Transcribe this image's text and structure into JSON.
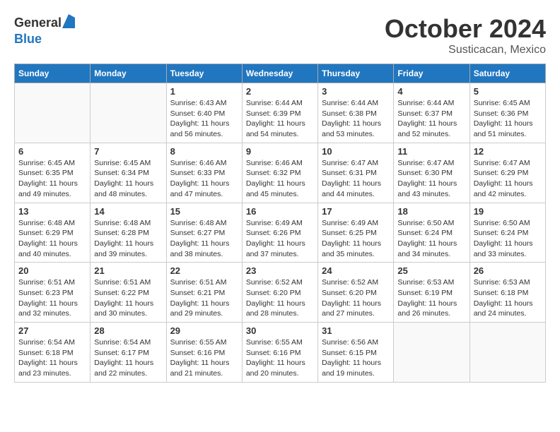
{
  "header": {
    "logo_general": "General",
    "logo_blue": "Blue",
    "month": "October 2024",
    "location": "Susticacan, Mexico"
  },
  "weekdays": [
    "Sunday",
    "Monday",
    "Tuesday",
    "Wednesday",
    "Thursday",
    "Friday",
    "Saturday"
  ],
  "weeks": [
    [
      {
        "day": "",
        "info": ""
      },
      {
        "day": "",
        "info": ""
      },
      {
        "day": "1",
        "info": "Sunrise: 6:43 AM\nSunset: 6:40 PM\nDaylight: 11 hours and 56 minutes."
      },
      {
        "day": "2",
        "info": "Sunrise: 6:44 AM\nSunset: 6:39 PM\nDaylight: 11 hours and 54 minutes."
      },
      {
        "day": "3",
        "info": "Sunrise: 6:44 AM\nSunset: 6:38 PM\nDaylight: 11 hours and 53 minutes."
      },
      {
        "day": "4",
        "info": "Sunrise: 6:44 AM\nSunset: 6:37 PM\nDaylight: 11 hours and 52 minutes."
      },
      {
        "day": "5",
        "info": "Sunrise: 6:45 AM\nSunset: 6:36 PM\nDaylight: 11 hours and 51 minutes."
      }
    ],
    [
      {
        "day": "6",
        "info": "Sunrise: 6:45 AM\nSunset: 6:35 PM\nDaylight: 11 hours and 49 minutes."
      },
      {
        "day": "7",
        "info": "Sunrise: 6:45 AM\nSunset: 6:34 PM\nDaylight: 11 hours and 48 minutes."
      },
      {
        "day": "8",
        "info": "Sunrise: 6:46 AM\nSunset: 6:33 PM\nDaylight: 11 hours and 47 minutes."
      },
      {
        "day": "9",
        "info": "Sunrise: 6:46 AM\nSunset: 6:32 PM\nDaylight: 11 hours and 45 minutes."
      },
      {
        "day": "10",
        "info": "Sunrise: 6:47 AM\nSunset: 6:31 PM\nDaylight: 11 hours and 44 minutes."
      },
      {
        "day": "11",
        "info": "Sunrise: 6:47 AM\nSunset: 6:30 PM\nDaylight: 11 hours and 43 minutes."
      },
      {
        "day": "12",
        "info": "Sunrise: 6:47 AM\nSunset: 6:29 PM\nDaylight: 11 hours and 42 minutes."
      }
    ],
    [
      {
        "day": "13",
        "info": "Sunrise: 6:48 AM\nSunset: 6:29 PM\nDaylight: 11 hours and 40 minutes."
      },
      {
        "day": "14",
        "info": "Sunrise: 6:48 AM\nSunset: 6:28 PM\nDaylight: 11 hours and 39 minutes."
      },
      {
        "day": "15",
        "info": "Sunrise: 6:48 AM\nSunset: 6:27 PM\nDaylight: 11 hours and 38 minutes."
      },
      {
        "day": "16",
        "info": "Sunrise: 6:49 AM\nSunset: 6:26 PM\nDaylight: 11 hours and 37 minutes."
      },
      {
        "day": "17",
        "info": "Sunrise: 6:49 AM\nSunset: 6:25 PM\nDaylight: 11 hours and 35 minutes."
      },
      {
        "day": "18",
        "info": "Sunrise: 6:50 AM\nSunset: 6:24 PM\nDaylight: 11 hours and 34 minutes."
      },
      {
        "day": "19",
        "info": "Sunrise: 6:50 AM\nSunset: 6:24 PM\nDaylight: 11 hours and 33 minutes."
      }
    ],
    [
      {
        "day": "20",
        "info": "Sunrise: 6:51 AM\nSunset: 6:23 PM\nDaylight: 11 hours and 32 minutes."
      },
      {
        "day": "21",
        "info": "Sunrise: 6:51 AM\nSunset: 6:22 PM\nDaylight: 11 hours and 30 minutes."
      },
      {
        "day": "22",
        "info": "Sunrise: 6:51 AM\nSunset: 6:21 PM\nDaylight: 11 hours and 29 minutes."
      },
      {
        "day": "23",
        "info": "Sunrise: 6:52 AM\nSunset: 6:20 PM\nDaylight: 11 hours and 28 minutes."
      },
      {
        "day": "24",
        "info": "Sunrise: 6:52 AM\nSunset: 6:20 PM\nDaylight: 11 hours and 27 minutes."
      },
      {
        "day": "25",
        "info": "Sunrise: 6:53 AM\nSunset: 6:19 PM\nDaylight: 11 hours and 26 minutes."
      },
      {
        "day": "26",
        "info": "Sunrise: 6:53 AM\nSunset: 6:18 PM\nDaylight: 11 hours and 24 minutes."
      }
    ],
    [
      {
        "day": "27",
        "info": "Sunrise: 6:54 AM\nSunset: 6:18 PM\nDaylight: 11 hours and 23 minutes."
      },
      {
        "day": "28",
        "info": "Sunrise: 6:54 AM\nSunset: 6:17 PM\nDaylight: 11 hours and 22 minutes."
      },
      {
        "day": "29",
        "info": "Sunrise: 6:55 AM\nSunset: 6:16 PM\nDaylight: 11 hours and 21 minutes."
      },
      {
        "day": "30",
        "info": "Sunrise: 6:55 AM\nSunset: 6:16 PM\nDaylight: 11 hours and 20 minutes."
      },
      {
        "day": "31",
        "info": "Sunrise: 6:56 AM\nSunset: 6:15 PM\nDaylight: 11 hours and 19 minutes."
      },
      {
        "day": "",
        "info": ""
      },
      {
        "day": "",
        "info": ""
      }
    ]
  ]
}
